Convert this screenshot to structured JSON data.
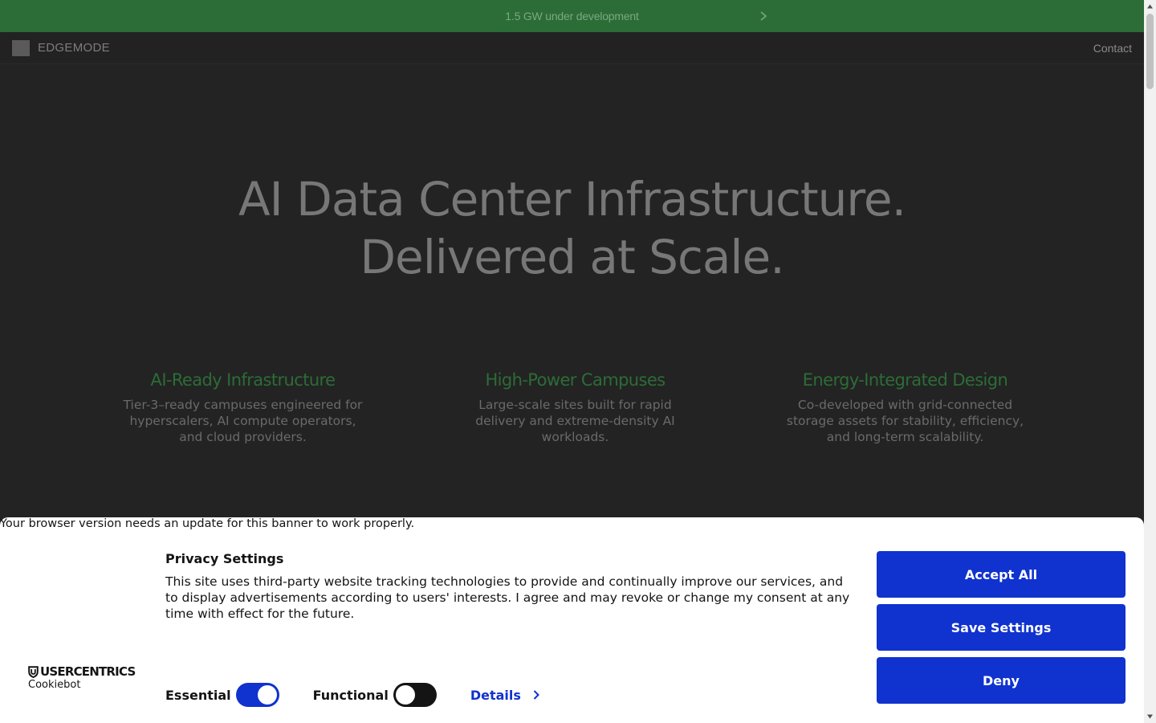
{
  "announcement": {
    "text": "1.5 GW under development",
    "icon": "chevron-right-icon"
  },
  "nav": {
    "brand": "EDGEMODE",
    "contact": "Contact"
  },
  "hero": {
    "line1": "AI Data Center Infrastructure.",
    "line2": "Delivered at Scale."
  },
  "features": [
    {
      "title": "AI-Ready Infrastructure",
      "lines": [
        "Tier-3–ready campuses engineered for",
        "hyperscalers, AI compute operators,",
        "and cloud providers."
      ]
    },
    {
      "title": "High-Power Campuses",
      "lines": [
        "Large-scale sites built for rapid",
        "delivery and extreme-density AI",
        "workloads."
      ]
    },
    {
      "title": "Energy-Integrated Design",
      "lines": [
        "Co-developed with grid-connected",
        "storage assets for stability, efficiency,",
        "and long-term scalability."
      ]
    }
  ],
  "cookie": {
    "warning": "Your browser version needs an update for this banner to work properly.",
    "title": "Privacy Settings",
    "body": "This site uses third-party website tracking technologies to provide and continually improve our services, and to display advertisements according to users' interests. I agree and may revoke or change my consent at any time with effect for the future.",
    "logo": {
      "brand": "USERCENTRICS",
      "sub": "Cookiebot"
    },
    "toggles": [
      {
        "label": "Essential",
        "on": true
      },
      {
        "label": "Functional",
        "on": false
      }
    ],
    "details": "Details",
    "buttons": {
      "accept": "Accept All",
      "save": "Save Settings",
      "deny": "Deny"
    }
  },
  "colors": {
    "announcement_bg": "#2c6c37",
    "page_bg": "#232323",
    "feature_title": "#2c6c37",
    "cookie_button": "#1032cf"
  }
}
